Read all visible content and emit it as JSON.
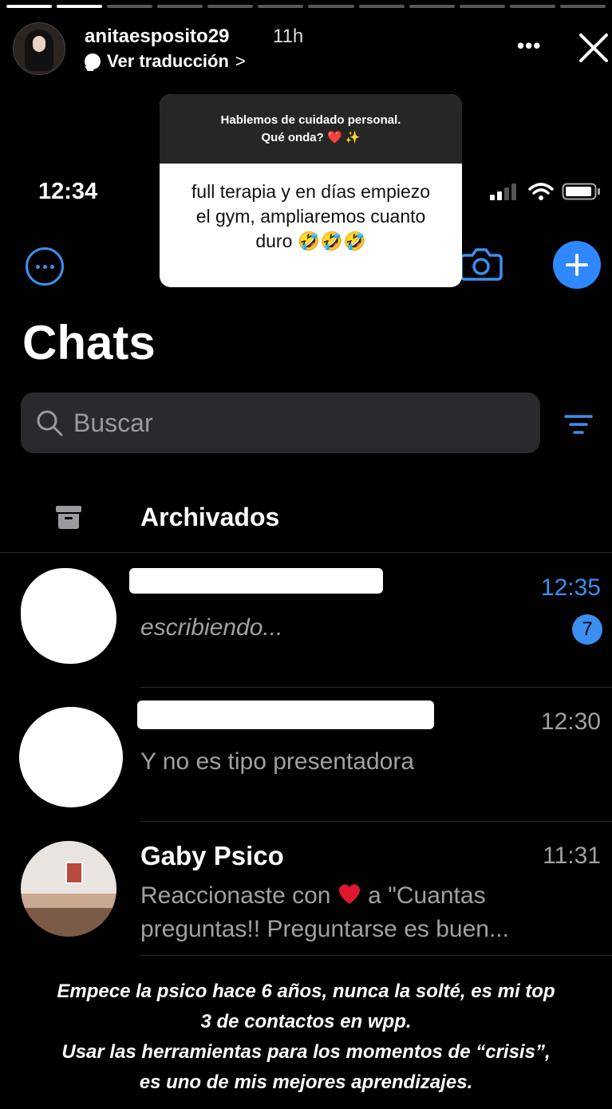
{
  "story": {
    "username": "anitaesposito29",
    "time_ago": "11h",
    "translate_label": "Ver traducción",
    "translate_chevron": ">",
    "more_icon": "more-horizontal-icon",
    "progress_segments": 12,
    "progress_done": 2
  },
  "question_sticker": {
    "question_line1": "Hablemos de cuidado personal.",
    "question_line2": "Qué onda? ❤️ ✨",
    "answer_line1": "full terapia y en días empiezo",
    "answer_line2": "el gym, ampliaremos cuanto",
    "answer_line3": "duro 🤣🤣🤣"
  },
  "phone": {
    "clock": "12:34",
    "accent_color": "#3b8ff0"
  },
  "chats_screen": {
    "title": "Chats",
    "search_placeholder": "Buscar",
    "archived_label": "Archivados",
    "chats": [
      {
        "name": "",
        "message": "escribiendo...",
        "time": "12:35",
        "unread": "7"
      },
      {
        "name": "",
        "message": "Y no es tipo presentadora",
        "time": "12:30"
      },
      {
        "name": "Gaby Psico",
        "message_prefix": "Reaccionaste con",
        "message_suffix": "a \"Cuantas",
        "message_line2": "preguntas!! Preguntarse es buen...",
        "time": "11:31"
      }
    ]
  },
  "caption": {
    "line1": "Empece la psico hace 6 años, nunca la solté, es mi top",
    "line2": "3 de contactos en wpp.",
    "line3": "Usar las herramientas para los momentos de “crisis”,",
    "line4": "es uno de mis mejores aprendizajes."
  }
}
